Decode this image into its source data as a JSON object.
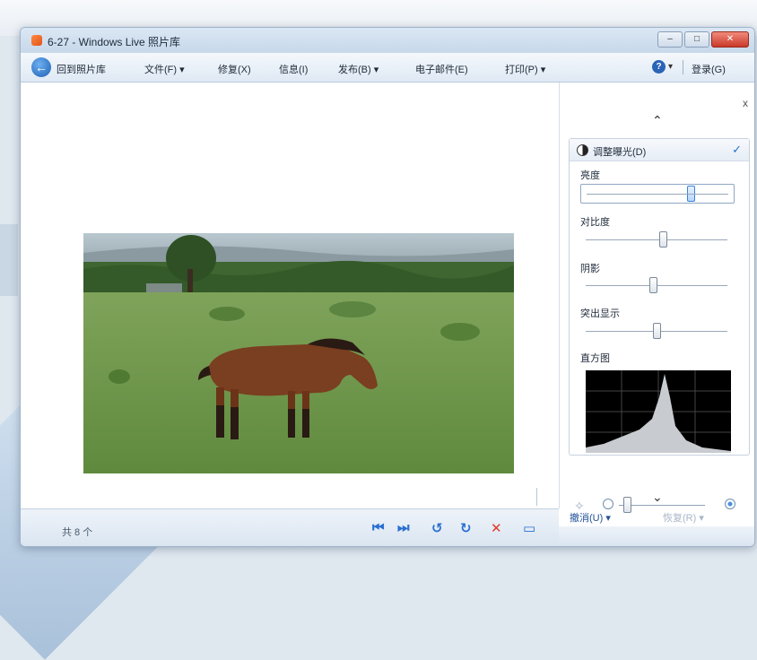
{
  "window": {
    "title": "6-27 - Windows Live 照片库",
    "buttons": [
      "–",
      "□",
      "✕"
    ]
  },
  "menubar": {
    "back_label": "回到照片库",
    "items": [
      {
        "label": "文件(F) ▾"
      },
      {
        "label": "修复(X)"
      },
      {
        "label": "信息(I)"
      },
      {
        "label": "发布(B) ▾"
      },
      {
        "label": "电子邮件(E)"
      },
      {
        "label": "打印(P) ▾"
      }
    ],
    "help_label": "?",
    "signin_label": "登录(G)"
  },
  "photo": {
    "description": "horse in field"
  },
  "panel": {
    "close_label": "x",
    "up_label": "⌃",
    "down_label": "⌄",
    "header_label": "调整曝光(D)",
    "check_label": "✓",
    "sliders": [
      {
        "label": "亮度",
        "value": 0.72
      },
      {
        "label": "对比度",
        "value": 0.55
      },
      {
        "label": "阴影",
        "value": 0.48
      },
      {
        "label": "突出显示",
        "value": 0.5
      }
    ],
    "histogram_label": "直方图",
    "undo_label": "撤消(U) ▾",
    "redo_label": "恢复(R) ▾"
  },
  "statusbar": {
    "text": "共 8 个",
    "controls": [
      "⏮",
      "⏭",
      "↺",
      "↻",
      "✕",
      "▭"
    ],
    "zoom": 0.1
  },
  "colors": {
    "accent": "#2a6fd1",
    "delete": "#e23b2a"
  }
}
